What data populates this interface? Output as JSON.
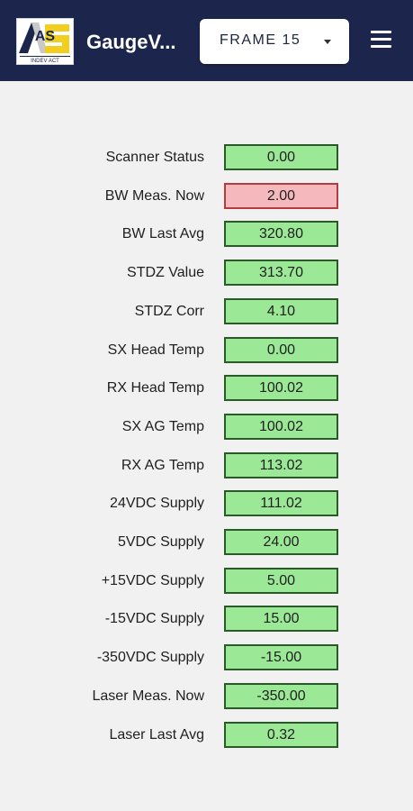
{
  "header": {
    "logo_text": "AS",
    "logo_tagline": "INDEV ACT",
    "title": "GaugeV...",
    "frame_select": "FRAME 15",
    "colors": {
      "bar": "#1c254c",
      "ok": "#9be896",
      "alarm": "#f4b8bd"
    }
  },
  "rows": [
    {
      "label": "Scanner Status",
      "value": "0.00",
      "status": "ok"
    },
    {
      "label": "BW Meas. Now",
      "value": "2.00",
      "status": "alarm"
    },
    {
      "label": "BW Last Avg",
      "value": "320.80",
      "status": "ok"
    },
    {
      "label": "STDZ Value",
      "value": "313.70",
      "status": "ok"
    },
    {
      "label": "STDZ Corr",
      "value": "4.10",
      "status": "ok"
    },
    {
      "label": "SX Head Temp",
      "value": "0.00",
      "status": "ok"
    },
    {
      "label": "RX Head Temp",
      "value": "100.02",
      "status": "ok"
    },
    {
      "label": "SX AG Temp",
      "value": "100.02",
      "status": "ok"
    },
    {
      "label": "RX AG Temp",
      "value": "113.02",
      "status": "ok"
    },
    {
      "label": "24VDC Supply",
      "value": "111.02",
      "status": "ok"
    },
    {
      "label": "5VDC Supply",
      "value": "24.00",
      "status": "ok"
    },
    {
      "label": "+15VDC Supply",
      "value": "5.00",
      "status": "ok"
    },
    {
      "label": "-15VDC Supply",
      "value": "15.00",
      "status": "ok"
    },
    {
      "label": "-350VDC Supply",
      "value": "-15.00",
      "status": "ok"
    },
    {
      "label": "Laser Meas. Now",
      "value": "-350.00",
      "status": "ok"
    },
    {
      "label": "Laser Last Avg",
      "value": "0.32",
      "status": "ok"
    }
  ]
}
